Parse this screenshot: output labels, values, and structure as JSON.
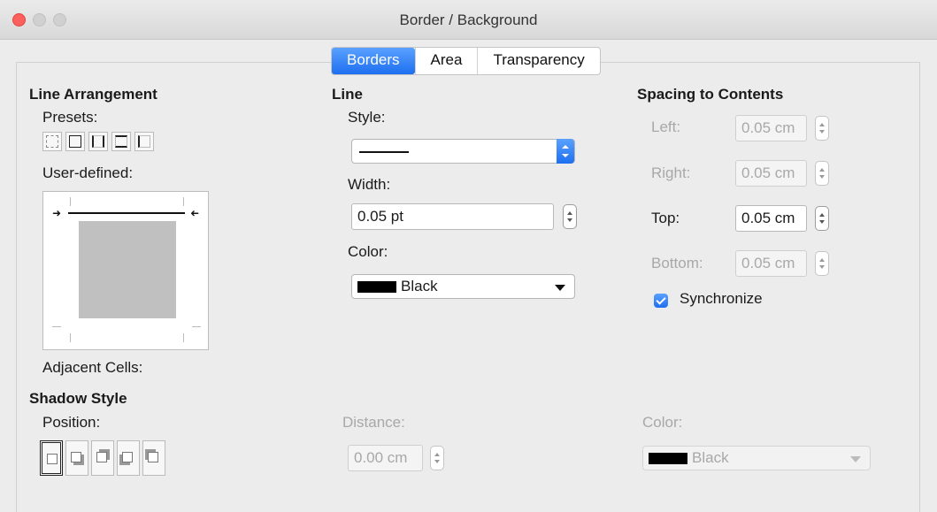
{
  "window": {
    "title": "Border / Background"
  },
  "tabs": [
    {
      "label": "Borders",
      "active": true
    },
    {
      "label": "Area",
      "active": false
    },
    {
      "label": "Transparency",
      "active": false
    }
  ],
  "line_arrangement": {
    "heading": "Line Arrangement",
    "presets_label": "Presets:",
    "user_defined_label": "User-defined:",
    "adjacent_cells_label": "Adjacent Cells:"
  },
  "line": {
    "heading": "Line",
    "style_label": "Style:",
    "width_label": "Width:",
    "width_value": "0.05 pt",
    "color_label": "Color:",
    "color_value": "Black"
  },
  "spacing": {
    "heading": "Spacing to Contents",
    "left_label": "Left:",
    "left_value": "0.05 cm",
    "right_label": "Right:",
    "right_value": "0.05 cm",
    "top_label": "Top:",
    "top_value": "0.05 cm",
    "bottom_label": "Bottom:",
    "bottom_value": "0.05 cm",
    "synchronize_label": "Synchronize",
    "synchronize_checked": true
  },
  "shadow": {
    "heading": "Shadow Style",
    "position_label": "Position:",
    "distance_label": "Distance:",
    "distance_value": "0.00 cm",
    "color_label": "Color:",
    "color_value": "Black"
  },
  "colors": {
    "accent": "#1e6ff0",
    "swatch_black": "#000000"
  }
}
